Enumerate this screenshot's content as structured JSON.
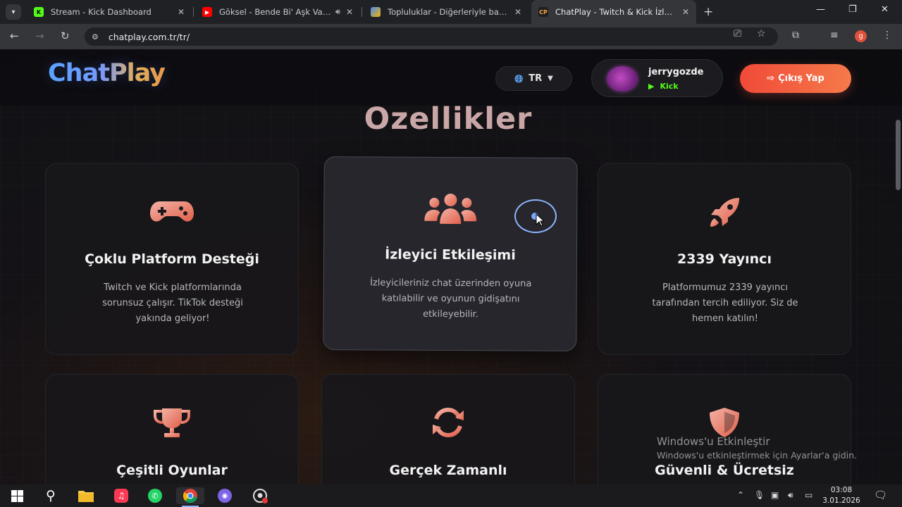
{
  "browser": {
    "tabs": [
      {
        "title": "Stream - Kick Dashboard",
        "favicon": "kick-icon",
        "active": false
      },
      {
        "title": "Göksel - Bende Bi' Aşk Var (",
        "favicon": "youtube-icon",
        "active": false,
        "audio": true
      },
      {
        "title": "Topluluklar - Diğerleriyle bağlan",
        "favicon": "community-icon",
        "active": false
      },
      {
        "title": "ChatPlay - Twitch & Kick İzleyici",
        "favicon_text": "CP",
        "active": true
      }
    ],
    "url": "chatplay.com.tr/tr/",
    "profile_initial": "g"
  },
  "site": {
    "logo": "ChatPlay",
    "language": "TR",
    "user": {
      "name": "jerrygozde",
      "platform": "Kick"
    },
    "logout_label": "Çıkış Yap"
  },
  "features": {
    "title": "Ozellikler",
    "cards": [
      {
        "icon": "gamepad-icon",
        "title": "Çoklu Platform Desteği",
        "desc": [
          "Twitch ve Kick platformlarında",
          "sorunsuz çalışır. TikTok desteği",
          "yakında geliyor!"
        ]
      },
      {
        "icon": "users-icon",
        "title": "İzleyici Etkileşimi",
        "desc": [
          "İzleyicileriniz chat üzerinden oyuna",
          "katılabilir ve oyunun gidişatını",
          "etkileyebilir."
        ]
      },
      {
        "icon": "rocket-icon",
        "title": "2339 Yayıncı",
        "desc": [
          "Platformumuz 2339 yayıncı",
          "tarafından tercih ediliyor. Siz de",
          "hemen katılın!"
        ]
      },
      {
        "icon": "trophy-icon",
        "title": "Çeşitli Oyunlar",
        "desc": []
      },
      {
        "icon": "sync-icon",
        "title": "Gerçek Zamanlı",
        "desc": []
      },
      {
        "icon": "shield-icon",
        "title": "Güvenli & Ücretsiz",
        "desc": []
      }
    ]
  },
  "watermark": {
    "title": "Windows'u Etkinleştir",
    "subtitle": "Windows'u etkinleştirmek için Ayarlar'a gidin."
  },
  "taskbar": {
    "time": "03:08",
    "date": "3.01.2026"
  },
  "colors": {
    "accent_orange": "#f04a38",
    "kick_green": "#53fc18",
    "icon_gradient_start": "#f0a89a",
    "icon_gradient_end": "#e0604a"
  }
}
